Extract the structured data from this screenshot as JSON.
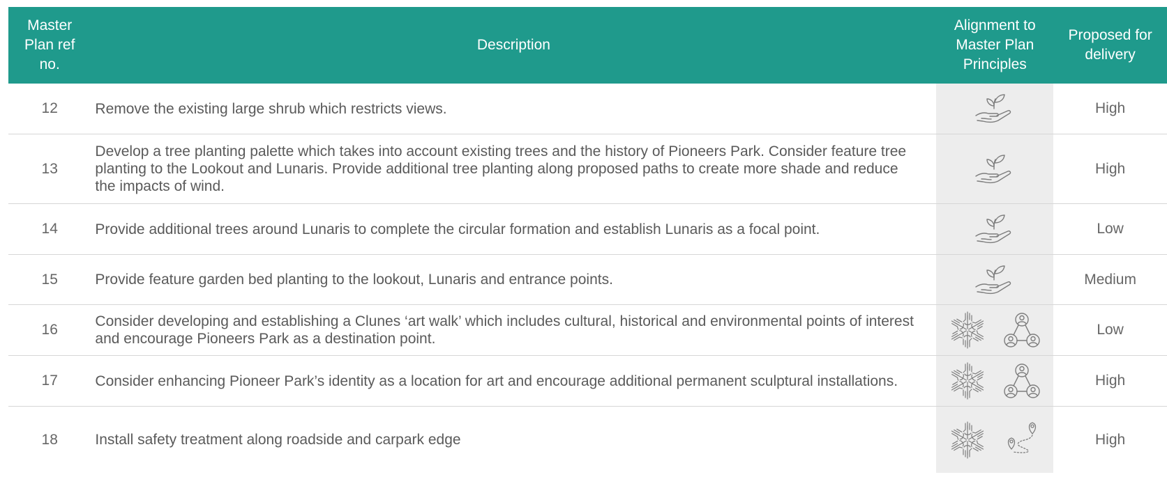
{
  "table": {
    "headers": {
      "ref": "Master\nPlan ref\nno.",
      "description": "Description",
      "alignment": "Alignment to\nMaster Plan\nPrinciples",
      "delivery": "Proposed for\ndelivery"
    },
    "rows": [
      {
        "ref": "12",
        "description": "Remove the existing large shrub which restricts views.",
        "icons": [
          "plant-hand-icon"
        ],
        "delivery": "High"
      },
      {
        "ref": "13",
        "description": "Develop a tree planting palette which takes into account existing trees and the history of Pioneers Park. Consider feature tree planting to the Lookout and Lunaris. Provide additional tree planting along proposed paths to create more shade and reduce the impacts of wind.",
        "icons": [
          "plant-hand-icon"
        ],
        "delivery": "High"
      },
      {
        "ref": "14",
        "description": "Provide additional trees around Lunaris to complete the circular formation and establish Lunaris as a focal point.",
        "icons": [
          "plant-hand-icon"
        ],
        "delivery": "Low"
      },
      {
        "ref": "15",
        "description": "Provide feature garden bed planting to the lookout, Lunaris and entrance points.",
        "icons": [
          "plant-hand-icon"
        ],
        "delivery": "Medium"
      },
      {
        "ref": "16",
        "description": "Consider developing and establishing a Clunes ‘art walk’ which includes cultural, historical and environmental points of interest and encourage Pioneers Park as a destination point.",
        "icons": [
          "hands-circle-icon",
          "people-network-icon"
        ],
        "delivery": "Low"
      },
      {
        "ref": "17",
        "description": "Consider enhancing Pioneer Park’s identity as a location for art and encourage additional permanent sculptural installations.",
        "icons": [
          "hands-circle-icon",
          "people-network-icon"
        ],
        "delivery": "High"
      },
      {
        "ref": "18",
        "description": "Install safety treatment along roadside and carpark edge",
        "icons": [
          "hands-circle-icon",
          "route-pins-icon"
        ],
        "delivery": "High"
      }
    ]
  }
}
